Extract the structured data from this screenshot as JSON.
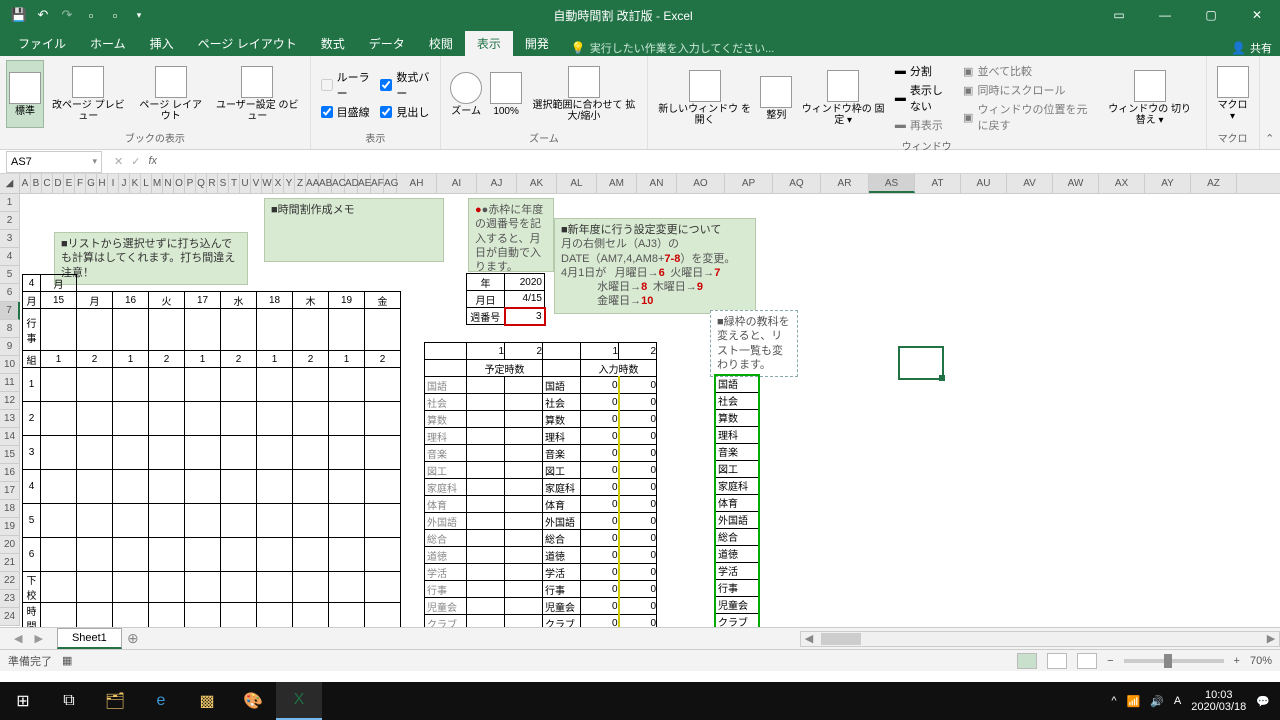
{
  "title": "自動時間割 改訂版 - Excel",
  "tabs": {
    "file": "ファイル",
    "home": "ホーム",
    "insert": "挿入",
    "layout": "ページ レイアウト",
    "formulas": "数式",
    "data": "データ",
    "review": "校閲",
    "view": "表示",
    "dev": "開発"
  },
  "tellme": "実行したい作業を入力してください...",
  "share": "共有",
  "ribbon": {
    "views": {
      "normal": "標準",
      "pagebreak": "改ページ\nプレビュー",
      "pagelayout": "ページ\nレイアウト",
      "custom": "ユーザー設定\nのビュー",
      "label": "ブックの表示"
    },
    "show": {
      "ruler": "ルーラー",
      "formulabar": "数式バー",
      "gridlines": "目盛線",
      "headings": "見出し",
      "label": "表示"
    },
    "zoom": {
      "zoom": "ズーム",
      "p100": "100%",
      "selection": "選択範囲に合わせて\n拡大/縮小",
      "label": "ズーム"
    },
    "window": {
      "newwin": "新しいウィンドウ\nを開く",
      "arrange": "整列",
      "freeze": "ウィンドウ枠の\n固定 ▾",
      "split": "分割",
      "hide": "表示しない",
      "unhide": "再表示",
      "side": "並べて比較",
      "sync": "同時にスクロール",
      "reset": "ウィンドウの位置を元に戻す",
      "switch": "ウィンドウの\n切り替え ▾",
      "label": "ウィンドウ"
    },
    "macro": {
      "macros": "マクロ\n▾",
      "label": "マクロ"
    }
  },
  "namebox": "AS7",
  "cols": [
    "A",
    "B",
    "C",
    "D",
    "E",
    "F",
    "G",
    "H",
    "I",
    "J",
    "K",
    "L",
    "M",
    "N",
    "O",
    "P",
    "Q",
    "R",
    "S",
    "T",
    "U",
    "V",
    "W",
    "X",
    "Y",
    "Z",
    "AA",
    "AB",
    "AC",
    "AD",
    "AE",
    "AF",
    "AG",
    "AH",
    "AI",
    "AJ",
    "AK",
    "AL",
    "AM",
    "AN",
    "AO",
    "AP",
    "AQ",
    "AR",
    "AS",
    "AT",
    "AU",
    "AV",
    "AW",
    "AX",
    "AY",
    "AZ"
  ],
  "note1": "■時間割作成メモ",
  "note2": "■リストから選択せずに打ち込んでも計算はしてくれます。打ち間違え注意！",
  "note3": {
    "l1": "●赤枠に年度の週番号を記入すると、月日が自動で入ります。"
  },
  "note4": {
    "title": "■新年度に行う設定変更について",
    "l2": "月の右側セル（AJ3）の",
    "l3a": "DATE（AM7,4,AM8+",
    "l3b": "7-8",
    "l3c": "）を変更。",
    "l4": "4月1日が",
    "mon": "月曜日→",
    "mon_n": "6",
    "tue": "火曜日→",
    "tue_n": "7",
    "wed": "水曜日→",
    "wed_n": "8",
    "thu": "木曜日→",
    "thu_n": "9",
    "fri": "金曜日→",
    "fri_n": "10"
  },
  "note5": "■緑枠の教科を変えると、リスト一覧も変わります。",
  "year_lbl": "年",
  "year_v": "2020",
  "month_lbl": "月日",
  "month_v": "4/15",
  "week_lbl": "週番号",
  "week_v": "3",
  "schedule": {
    "month": "4",
    "month_lbl": "月",
    "days": [
      "月",
      "15",
      "月",
      "16",
      "火",
      "17",
      "水",
      "18",
      "木",
      "19",
      "金"
    ],
    "rowlbls": [
      "行事",
      "組",
      "1",
      "2",
      "3",
      "4",
      "5",
      "6",
      "下校",
      "時間"
    ],
    "classnums": [
      "1",
      "2",
      "1",
      "2",
      "1",
      "2",
      "1",
      "2",
      "1",
      "2"
    ]
  },
  "subj_hdr": {
    "c1": "1",
    "c2": "2",
    "c3": "1",
    "c4": "2",
    "plan": "予定時数",
    "input": "入力時数"
  },
  "subjects": [
    "国語",
    "社会",
    "算数",
    "理科",
    "音楽",
    "図工",
    "家庭科",
    "体育",
    "外国語",
    "総合",
    "道徳",
    "学活",
    "行事",
    "児童会",
    "クラブ"
  ],
  "sheet_tab": "Sheet1",
  "status_ready": "準備完了",
  "zoom_pct": "70%",
  "clock": {
    "time": "10:03",
    "date": "2020/03/18"
  }
}
